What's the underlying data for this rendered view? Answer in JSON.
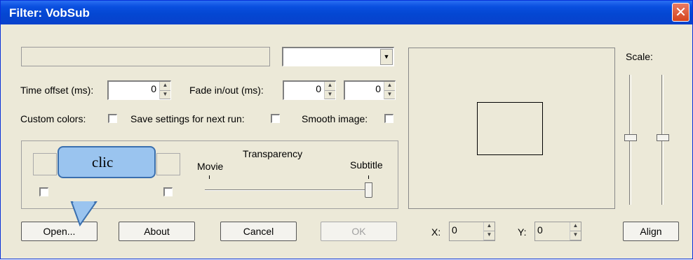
{
  "window": {
    "title": "Filter: VobSub",
    "close_glyph": "✕"
  },
  "top": {
    "filename_value": "",
    "lang_select_value": "",
    "dropdown_glyph": "▼"
  },
  "time_offset": {
    "label": "Time offset (ms):",
    "value": "0"
  },
  "fade": {
    "label": "Fade in/out (ms):",
    "in_value": "0",
    "out_value": "0"
  },
  "checkboxes": {
    "custom_colors": "Custom colors:",
    "save_settings": "Save settings for next run:",
    "smooth_image": "Smooth image:"
  },
  "transparency": {
    "title": "Transparency",
    "left": "Movie",
    "right": "Subtitle"
  },
  "scale": {
    "label": "Scale:"
  },
  "position": {
    "x_label": "X:",
    "x_value": "0",
    "y_label": "Y:",
    "y_value": "0"
  },
  "buttons": {
    "open": "Open...",
    "about": "About",
    "cancel": "Cancel",
    "ok": "OK",
    "align": "Align"
  },
  "annotation": {
    "callout_text": "clic"
  },
  "spin_glyphs": {
    "up": "▲",
    "down": "▼"
  }
}
